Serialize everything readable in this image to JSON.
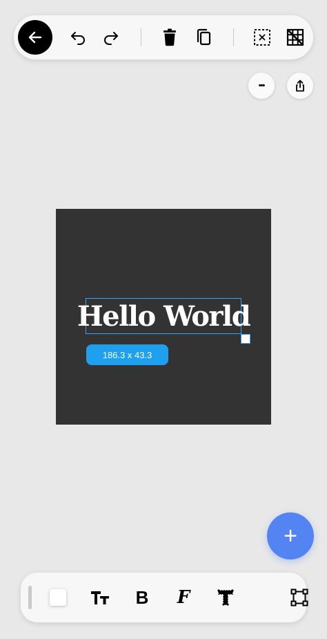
{
  "canvas": {
    "text": "Hello World",
    "size_label": "186.3 x 43.3",
    "background_color": "#333333",
    "text_color": "#ffffff",
    "selection_color": "#3ba3f5"
  },
  "top_toolbar": {
    "icons": [
      "back-arrow-icon",
      "undo-icon",
      "redo-icon",
      "trash-icon",
      "duplicate-icon",
      "deselect-icon",
      "grid-off-icon"
    ]
  },
  "actions": {
    "more_label": "•••",
    "icons": [
      "more-icon",
      "share-icon"
    ]
  },
  "fab": {
    "label": "+",
    "color": "#5483f2"
  },
  "bottom_toolbar": {
    "bold_label": "B",
    "font_label": "F",
    "swatch_color": "#ffffff",
    "icons": [
      "color-swatch",
      "text-size-icon",
      "bold-icon",
      "font-family-icon",
      "text-outline-icon",
      "transform-icon"
    ]
  },
  "colors": {
    "background": "#e8e8e8",
    "accent_blue": "#1fa0ef"
  }
}
